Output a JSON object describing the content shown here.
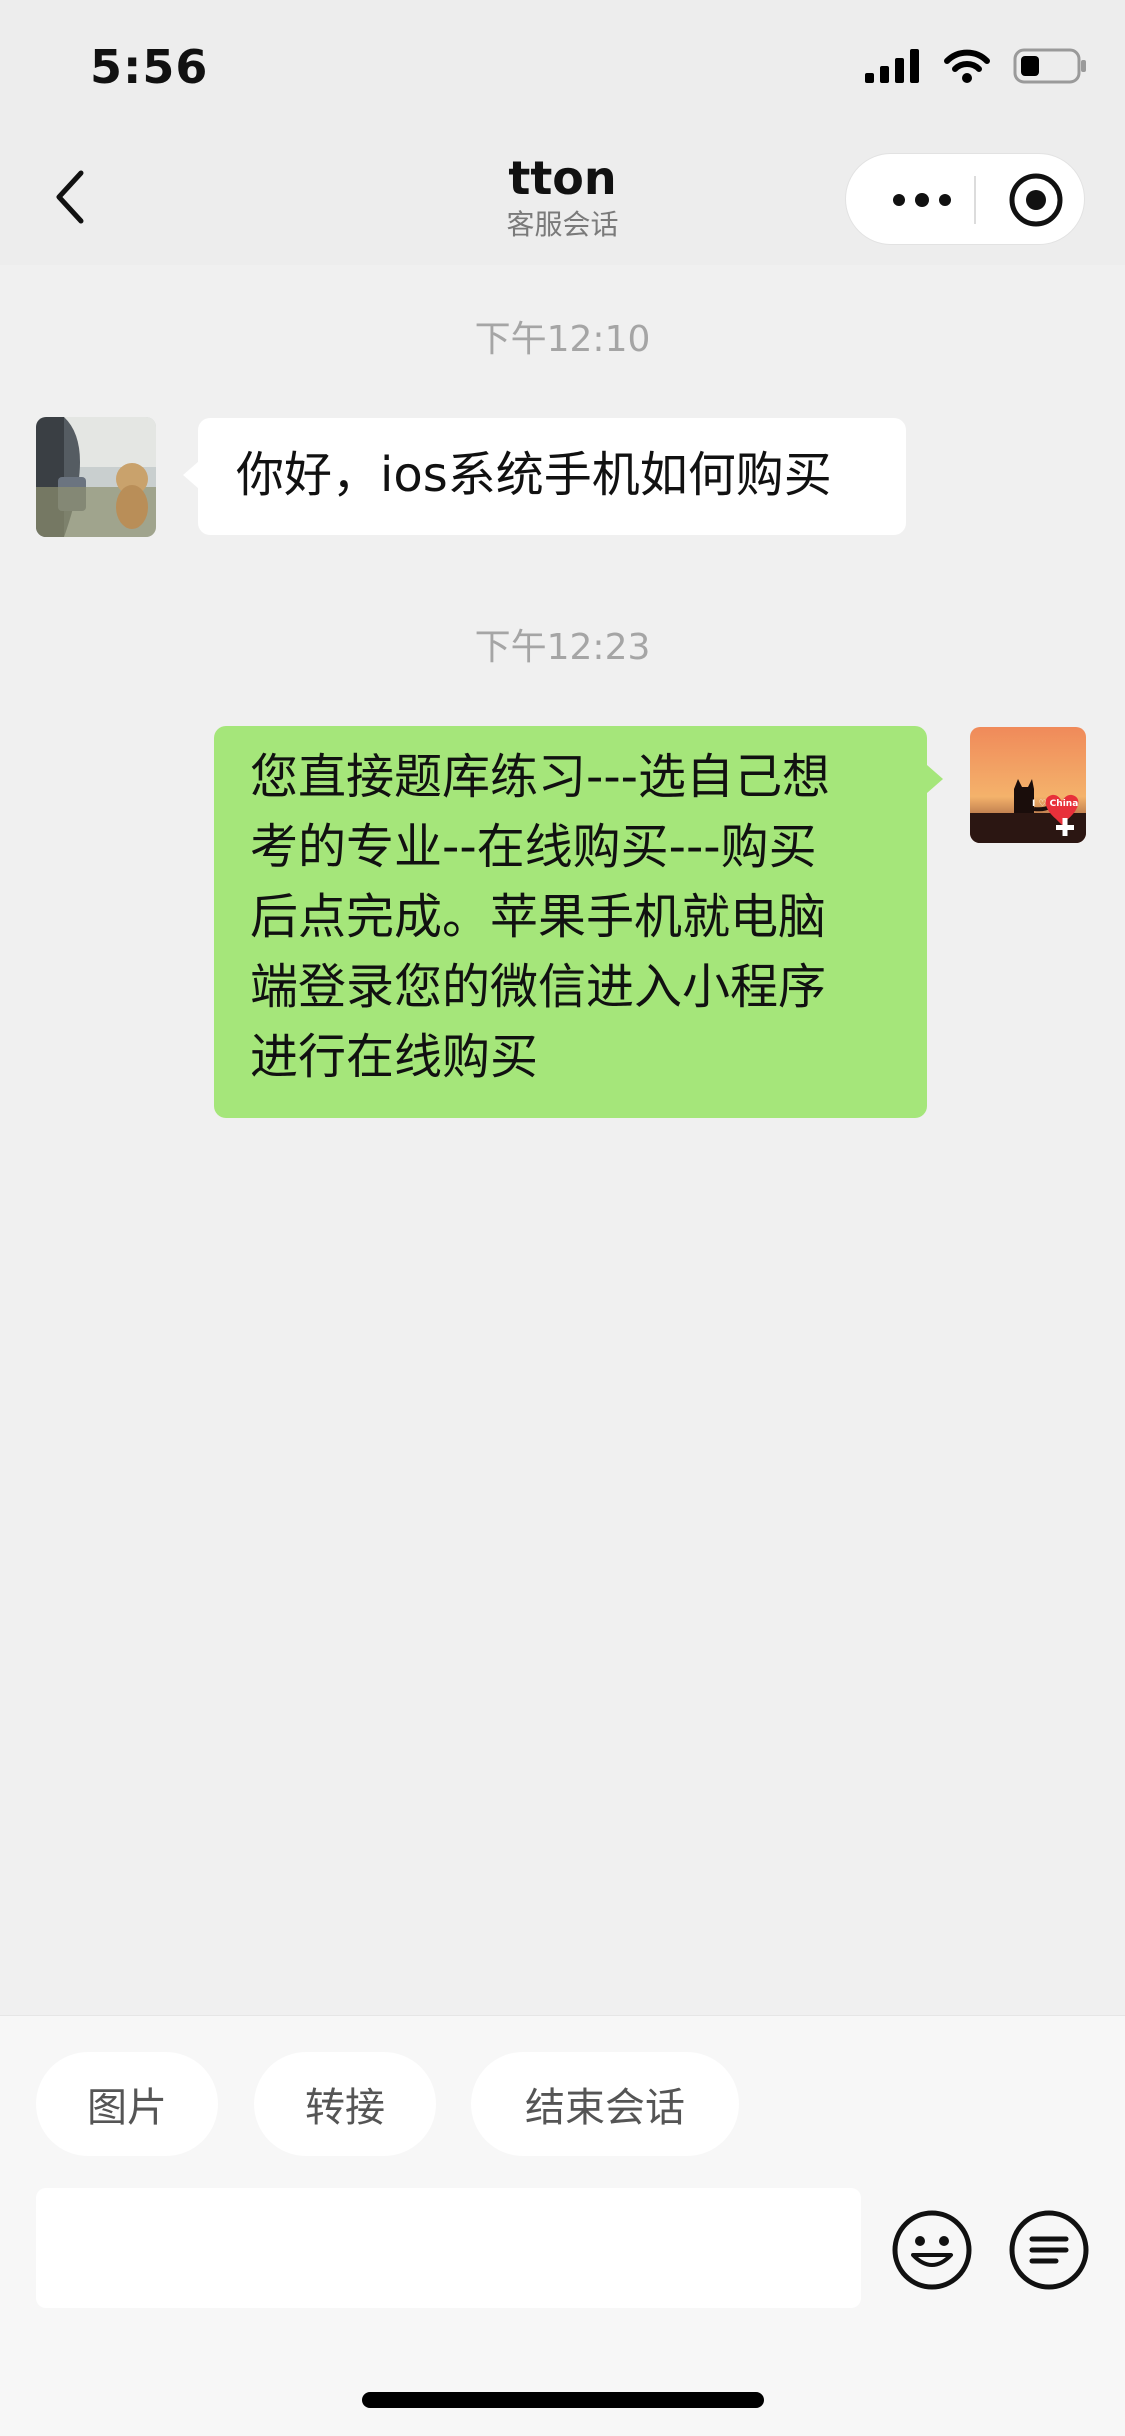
{
  "status_bar": {
    "time": "5:56"
  },
  "nav": {
    "title": "tton",
    "subtitle": "客服会话"
  },
  "chat": {
    "timestamps": [
      "下午12:10",
      "下午12:23"
    ],
    "messages": [
      {
        "side": "left",
        "text": "你好，ios系统手机如何购买"
      },
      {
        "side": "right",
        "lines": [
          "您直接题库练习---选自己想",
          "考的专业--在线购买---购买",
          "后点完成。苹果手机就电脑",
          "端登录您的微信进入小程序",
          "进行在线购买"
        ]
      }
    ],
    "self_avatar_text": "I ♡ China"
  },
  "quick_actions": [
    "图片",
    "转接",
    "结束会话"
  ],
  "input": {
    "value": "",
    "placeholder": ""
  },
  "icons": {
    "back": "chevron-left-icon",
    "more": "more-dots-icon",
    "close": "close-miniprogram-icon",
    "emoji": "emoji-icon",
    "menu": "menu-icon"
  },
  "colors": {
    "bubble_self": "#a5e67a",
    "bubble_other": "#ffffff",
    "background": "#f0f0f0"
  }
}
